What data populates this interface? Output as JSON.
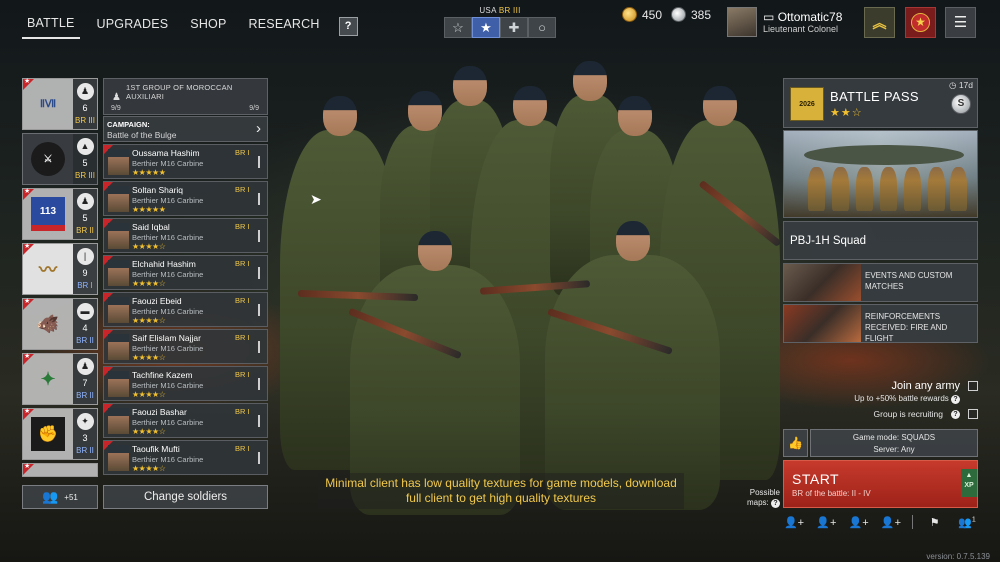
{
  "nav": {
    "items": [
      {
        "label": "BATTLE",
        "active": true
      },
      {
        "label": "UPGRADES",
        "active": false
      },
      {
        "label": "SHOP",
        "active": false
      },
      {
        "label": "RESEARCH",
        "active": false
      }
    ],
    "help_label": "?"
  },
  "army": {
    "country": "USA",
    "br": "BR III",
    "tabs": [
      {
        "icon": "star-outline-icon",
        "glyph": "☆"
      },
      {
        "icon": "star-filled-icon",
        "glyph": "★"
      },
      {
        "icon": "cross-icon",
        "glyph": "✚"
      },
      {
        "icon": "circle-icon",
        "glyph": "○"
      }
    ]
  },
  "currency": {
    "gold": "450",
    "silver": "385"
  },
  "profile": {
    "name": "Ottomatic78",
    "rank_title": "Lieutenant Colonel"
  },
  "squads": [
    {
      "kind_glyph": "♟",
      "count": "6",
      "br": "BR III",
      "emblem": "ⅡⅦ",
      "has_corner": true,
      "style": "light"
    },
    {
      "kind_glyph": "▲",
      "count": "5",
      "br": "BR III",
      "emblem": "⚔",
      "has_corner": false,
      "style": "light"
    },
    {
      "kind_glyph": "♟",
      "count": "5",
      "br": "BR II",
      "emblem": "113",
      "has_corner": true,
      "style": "light"
    },
    {
      "kind_glyph": "|",
      "count": "9",
      "br": "BR I",
      "emblem": "〰",
      "has_corner": true,
      "style": "active"
    },
    {
      "kind_glyph": "▬",
      "count": "4",
      "br": "BR II",
      "emblem": "🐗",
      "has_corner": true,
      "style": "light"
    },
    {
      "kind_glyph": "♟",
      "count": "7",
      "br": "BR II",
      "emblem": "✦",
      "has_corner": true,
      "style": "light"
    },
    {
      "kind_glyph": "✦",
      "count": "3",
      "br": "BR II",
      "emblem": "✊",
      "has_corner": true,
      "style": "light"
    },
    {
      "kind_glyph": "",
      "count": "",
      "br": "",
      "emblem": "",
      "has_corner": true,
      "style": "light"
    }
  ],
  "squad_info": {
    "name": "1ST GROUP OF MOROCCAN AUXILIARI",
    "left": "9/9",
    "right": "9/9"
  },
  "campaign": {
    "label": "CAMPAIGN:",
    "value": "Battle of the Bulge"
  },
  "soldiers": [
    {
      "name": "Oussama Hashim",
      "weapon": "Berthier M16 Carbine",
      "stars": "★★★★★",
      "br": "BR I"
    },
    {
      "name": "Soltan Shariq",
      "weapon": "Berthier M16 Carbine",
      "stars": "★★★★★",
      "br": "BR I"
    },
    {
      "name": "Said Iqbal",
      "weapon": "Berthier M16 Carbine",
      "stars": "★★★★☆",
      "br": "BR I"
    },
    {
      "name": "Elchahid Hashim",
      "weapon": "Berthier M16 Carbine",
      "stars": "★★★★☆",
      "br": "BR I"
    },
    {
      "name": "Faouzi Ebeid",
      "weapon": "Berthier M16 Carbine",
      "stars": "★★★★☆",
      "br": "BR I"
    },
    {
      "name": "Saif Elislam Najjar",
      "weapon": "Berthier M16 Carbine",
      "stars": "★★★★☆",
      "br": "BR I"
    },
    {
      "name": "Tachfine Kazem",
      "weapon": "Berthier M16 Carbine",
      "stars": "★★★★☆",
      "br": "BR I"
    },
    {
      "name": "Faouzi Bashar",
      "weapon": "Berthier M16 Carbine",
      "stars": "★★★★☆",
      "br": "BR I"
    },
    {
      "name": "Taoufik Mufti",
      "weapon": "Berthier M16 Carbine",
      "stars": "★★★★☆",
      "br": "BR I"
    }
  ],
  "reserve": {
    "count": "+51"
  },
  "change_soldiers_label": "Change soldiers",
  "battle_pass": {
    "title": "BATTLE PASS",
    "stars": "★★☆",
    "days": "17d",
    "icon_text": "2026",
    "coin_letter": "S"
  },
  "offer": {
    "name": "PBJ-1H Squad"
  },
  "news": [
    {
      "text": "EVENTS AND CUSTOM MATCHES"
    },
    {
      "text": "REINFORCEMENTS RECEIVED: FIRE AND FLIGHT"
    }
  ],
  "join_any_army": {
    "label": "Join any army",
    "sub": "Up to +50% battle rewards"
  },
  "group_recruiting": {
    "label": "Group is recruiting"
  },
  "game_mode": {
    "mode": "Game mode: SQUADS",
    "server": "Server: Any"
  },
  "start": {
    "label": "START",
    "sub": "BR of the battle: II - IV",
    "xp": "XP"
  },
  "possible_maps": "Possible maps:",
  "bottom_icons": [
    {
      "name": "invite-friend-icon",
      "glyph": "👤+"
    },
    {
      "name": "invite-friend-icon-2",
      "glyph": "👤+"
    },
    {
      "name": "invite-friend-icon-3",
      "glyph": "👤+"
    },
    {
      "name": "invite-friend-icon-4",
      "glyph": "👤+"
    },
    {
      "name": "flag-icon",
      "glyph": "⚑"
    },
    {
      "name": "group-icon",
      "glyph": "👥"
    }
  ],
  "group_badge": "1",
  "notice": "Minimal client has low quality textures for game models, download full client to get high quality textures",
  "version": "version: 0.7.5.139"
}
